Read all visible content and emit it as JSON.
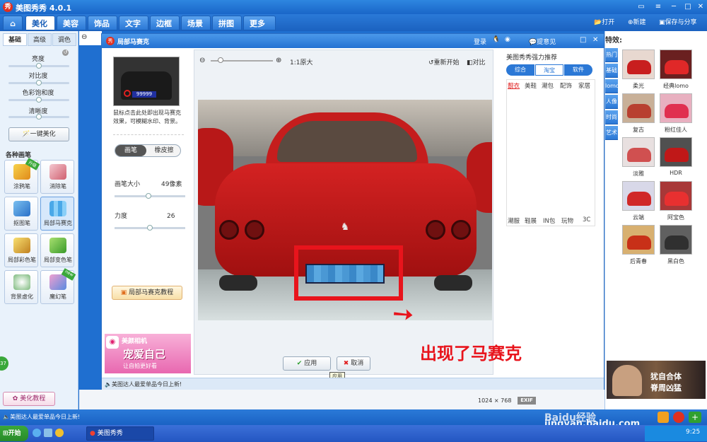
{
  "app": {
    "title": "美图秀秀 4.0.1",
    "logo_char": "秀"
  },
  "nav": {
    "tabs": [
      "美化",
      "美容",
      "饰品",
      "文字",
      "边框",
      "场景",
      "拼图",
      "更多功能"
    ],
    "open": "打开",
    "new": "新建",
    "save": "保存与分享"
  },
  "left": {
    "subtabs": [
      "基础",
      "高级",
      "调色"
    ],
    "sliders": [
      "亮度",
      "对比度",
      "色彩饱和度",
      "清晰度"
    ],
    "one_click": "一键美化",
    "brush_title": "各种画笔",
    "tools": [
      "涂鸦笔",
      "消除笔",
      "抠图笔",
      "局部马赛克",
      "局部彩色笔",
      "局部变色笔",
      "背景虚化",
      "魔幻笔"
    ],
    "badges": {
      "doodle": "升级",
      "magic": "new"
    },
    "tutorial": "美化教程",
    "bubble": "37"
  },
  "dialog": {
    "title": "局部马赛克",
    "login": "登录",
    "feedback": "提意见",
    "hint": "鼠标点击此处即出现马赛克效果，可模糊水印、背景。",
    "plate": "99999",
    "modes": [
      "画笔",
      "橡皮擦"
    ],
    "brush_size_label": "画笔大小",
    "brush_size_value": "49像素",
    "brush_size_level": 0.48,
    "strength_label": "力度",
    "strength_value": "26",
    "strength_level": 0.5,
    "tutorial": "局部马赛克教程",
    "ad_title": "美颜相机",
    "ad_main": "宠爱自己",
    "ad_sub": "让自拍更好看",
    "zoom_label": "1:1原大",
    "reset": "重新开始",
    "compare": "对比",
    "apply": "应用",
    "cancel": "取消",
    "tooltip": "应用",
    "status": "美图达人最爱单品今日上新!",
    "annotation": "出现了马赛克"
  },
  "recommend": {
    "title": "美图秀秀强力推荐",
    "segs": [
      "综合",
      "淘宝",
      "软件"
    ],
    "cats_top": [
      "靓衣",
      "美鞋",
      "潮包",
      "配饰",
      "家居"
    ],
    "cats_bottom": [
      "潮服",
      "鞋展",
      "IN包",
      "玩物",
      "3C"
    ]
  },
  "right": {
    "title": "特效:",
    "cats": [
      "热门",
      "基础",
      "lomo",
      "人像",
      "时尚",
      "艺术"
    ],
    "effects": [
      "柔光",
      "经典lomo",
      "复古",
      "粉红佳人",
      "淡雅",
      "HDR",
      "云端",
      "阿宝色",
      "后青春",
      "黑白色"
    ],
    "ad_text1": "犹自合体",
    "ad_text2": "脊周凶猛"
  },
  "footer": {
    "status": "美图达人最爱单品今日上新!",
    "dims": "1024 × 768",
    "exif": "EXIF",
    "watermark": "jingyan.baidu.com",
    "baidu": "Baidu经验"
  },
  "taskbar": {
    "start": "开始",
    "window": "美图秀秀",
    "time": "9:25"
  },
  "colors": {
    "brand": "#2b78d6",
    "annotation": "#e8141c",
    "apply": "#30a030"
  }
}
